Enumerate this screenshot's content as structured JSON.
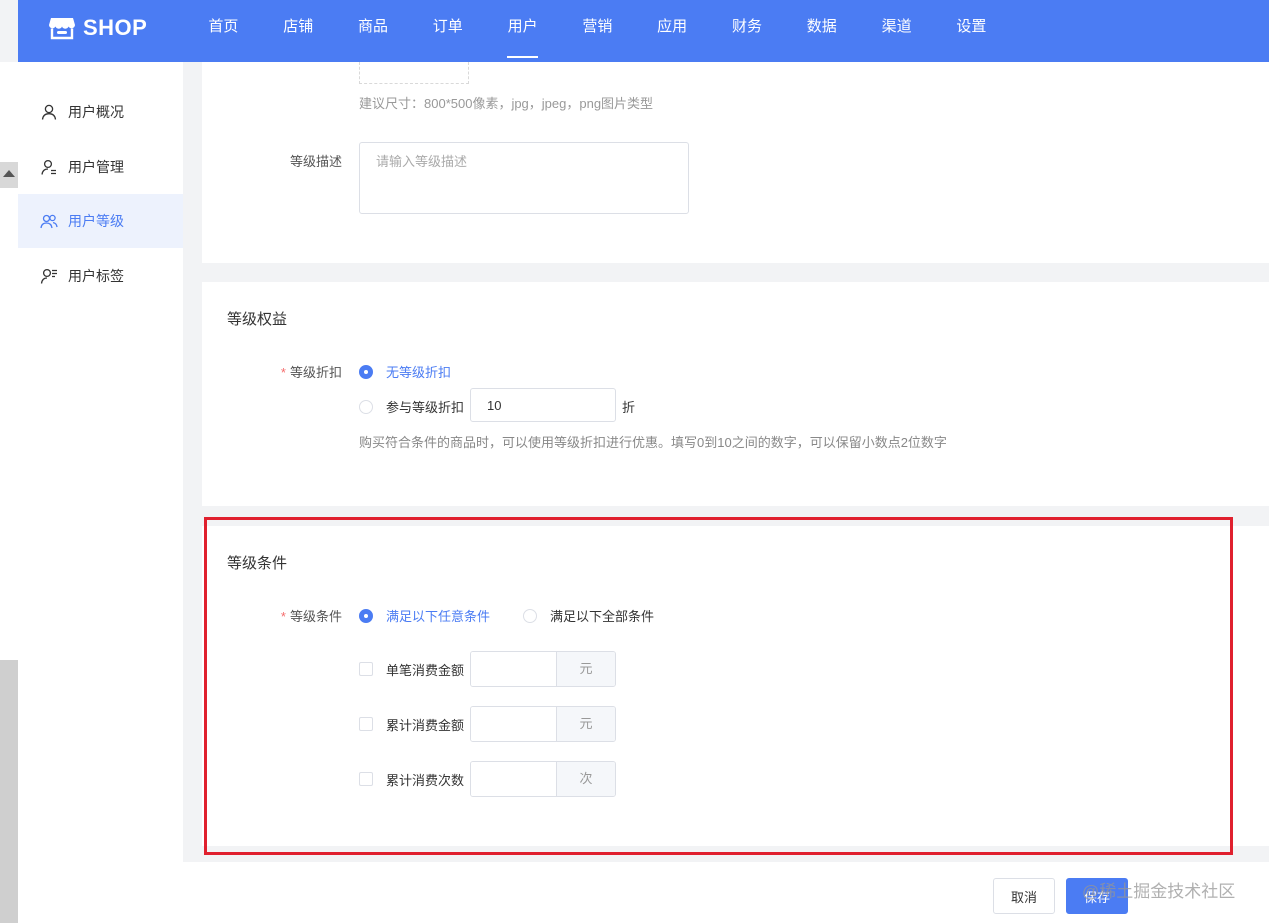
{
  "brand": {
    "name": "SHOP"
  },
  "nav": {
    "items": [
      "首页",
      "店铺",
      "商品",
      "订单",
      "用户",
      "营销",
      "应用",
      "财务",
      "数据",
      "渠道",
      "设置"
    ],
    "active_index": 4
  },
  "sidebar": {
    "items": [
      {
        "label": "用户概况",
        "icon": "user-icon",
        "active": false
      },
      {
        "label": "用户管理",
        "icon": "user-manage-icon",
        "active": false
      },
      {
        "label": "用户等级",
        "icon": "users-group-icon",
        "active": true
      },
      {
        "label": "用户标签",
        "icon": "user-tag-icon",
        "active": false
      }
    ]
  },
  "basic": {
    "image_hint": "建议尺寸：800*500像素，jpg，jpeg，png图片类型",
    "desc_label": "等级描述",
    "desc_placeholder": "请输入等级描述",
    "desc_value": ""
  },
  "benefits": {
    "title": "等级权益",
    "discount_label": "等级折扣",
    "option_none": "无等级折扣",
    "option_join": "参与等级折扣",
    "discount_value": "10",
    "discount_unit": "折",
    "hint": "购买符合条件的商品时，可以使用等级折扣进行优惠。填写0到10之间的数字，可以保留小数点2位数字"
  },
  "conditions": {
    "title": "等级条件",
    "label": "等级条件",
    "option_any": "满足以下任意条件",
    "option_all": "满足以下全部条件",
    "rows": [
      {
        "label": "单笔消费金额",
        "unit": "元",
        "value": ""
      },
      {
        "label": "累计消费金额",
        "unit": "元",
        "value": ""
      },
      {
        "label": "累计消费次数",
        "unit": "次",
        "value": ""
      }
    ]
  },
  "footer": {
    "cancel_label": "取消",
    "save_label": "保存",
    "watermark": "@稀土掘金技术社区"
  },
  "colors": {
    "primary": "#4b7cf3",
    "highlight": "#e0202e",
    "required": "#f56c6c"
  }
}
